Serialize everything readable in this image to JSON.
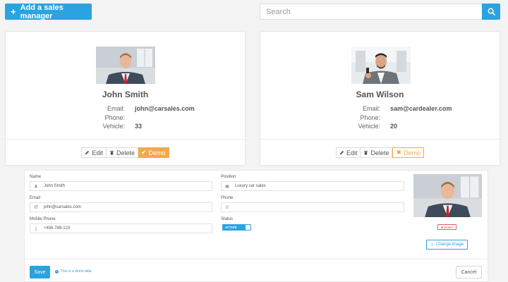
{
  "toolbar": {
    "add_button_label": "Add a sales manager",
    "search_placeholder": "Search"
  },
  "managers": [
    {
      "name": "John Smith",
      "email_label": "Email:",
      "email": "john@carsales.com",
      "phone_label": "Phone:",
      "phone": "",
      "vehicle_label": "Vehicle:",
      "vehicles": "33",
      "actions": {
        "edit": "Edit",
        "delete": "Delete",
        "demo": "Demo"
      },
      "demo_active": true
    },
    {
      "name": "Sam Wilson",
      "email_label": "Email:",
      "email": "sam@cardealer.com",
      "phone_label": "Phone:",
      "phone": "",
      "vehicle_label": "Vehicle:",
      "vehicles": "20",
      "actions": {
        "edit": "Edit",
        "delete": "Delete",
        "demo": "Demo"
      },
      "demo_active": false
    }
  ],
  "form": {
    "name_label": "Name",
    "name_value": "John Smith",
    "position_label": "Position",
    "position_value": "Luxury car sales",
    "email_label": "Email",
    "email_value": "john@carsales.com",
    "phone_label": "Phone",
    "phone_value": "",
    "mobile_label": "Mobile Phone",
    "mobile_value": "+456 789-123",
    "status_label": "Status",
    "status_value": "ACTIVE",
    "delete_photo_label": "Delete",
    "change_image_label": "Change image",
    "save_label": "Save",
    "demo_note": "This is a demo data",
    "cancel_label": "Cancel"
  },
  "colors": {
    "primary": "#2aa3e0",
    "demo_orange": "#f4a84c",
    "danger": "#e25a5a",
    "background": "#f3f3f4"
  }
}
